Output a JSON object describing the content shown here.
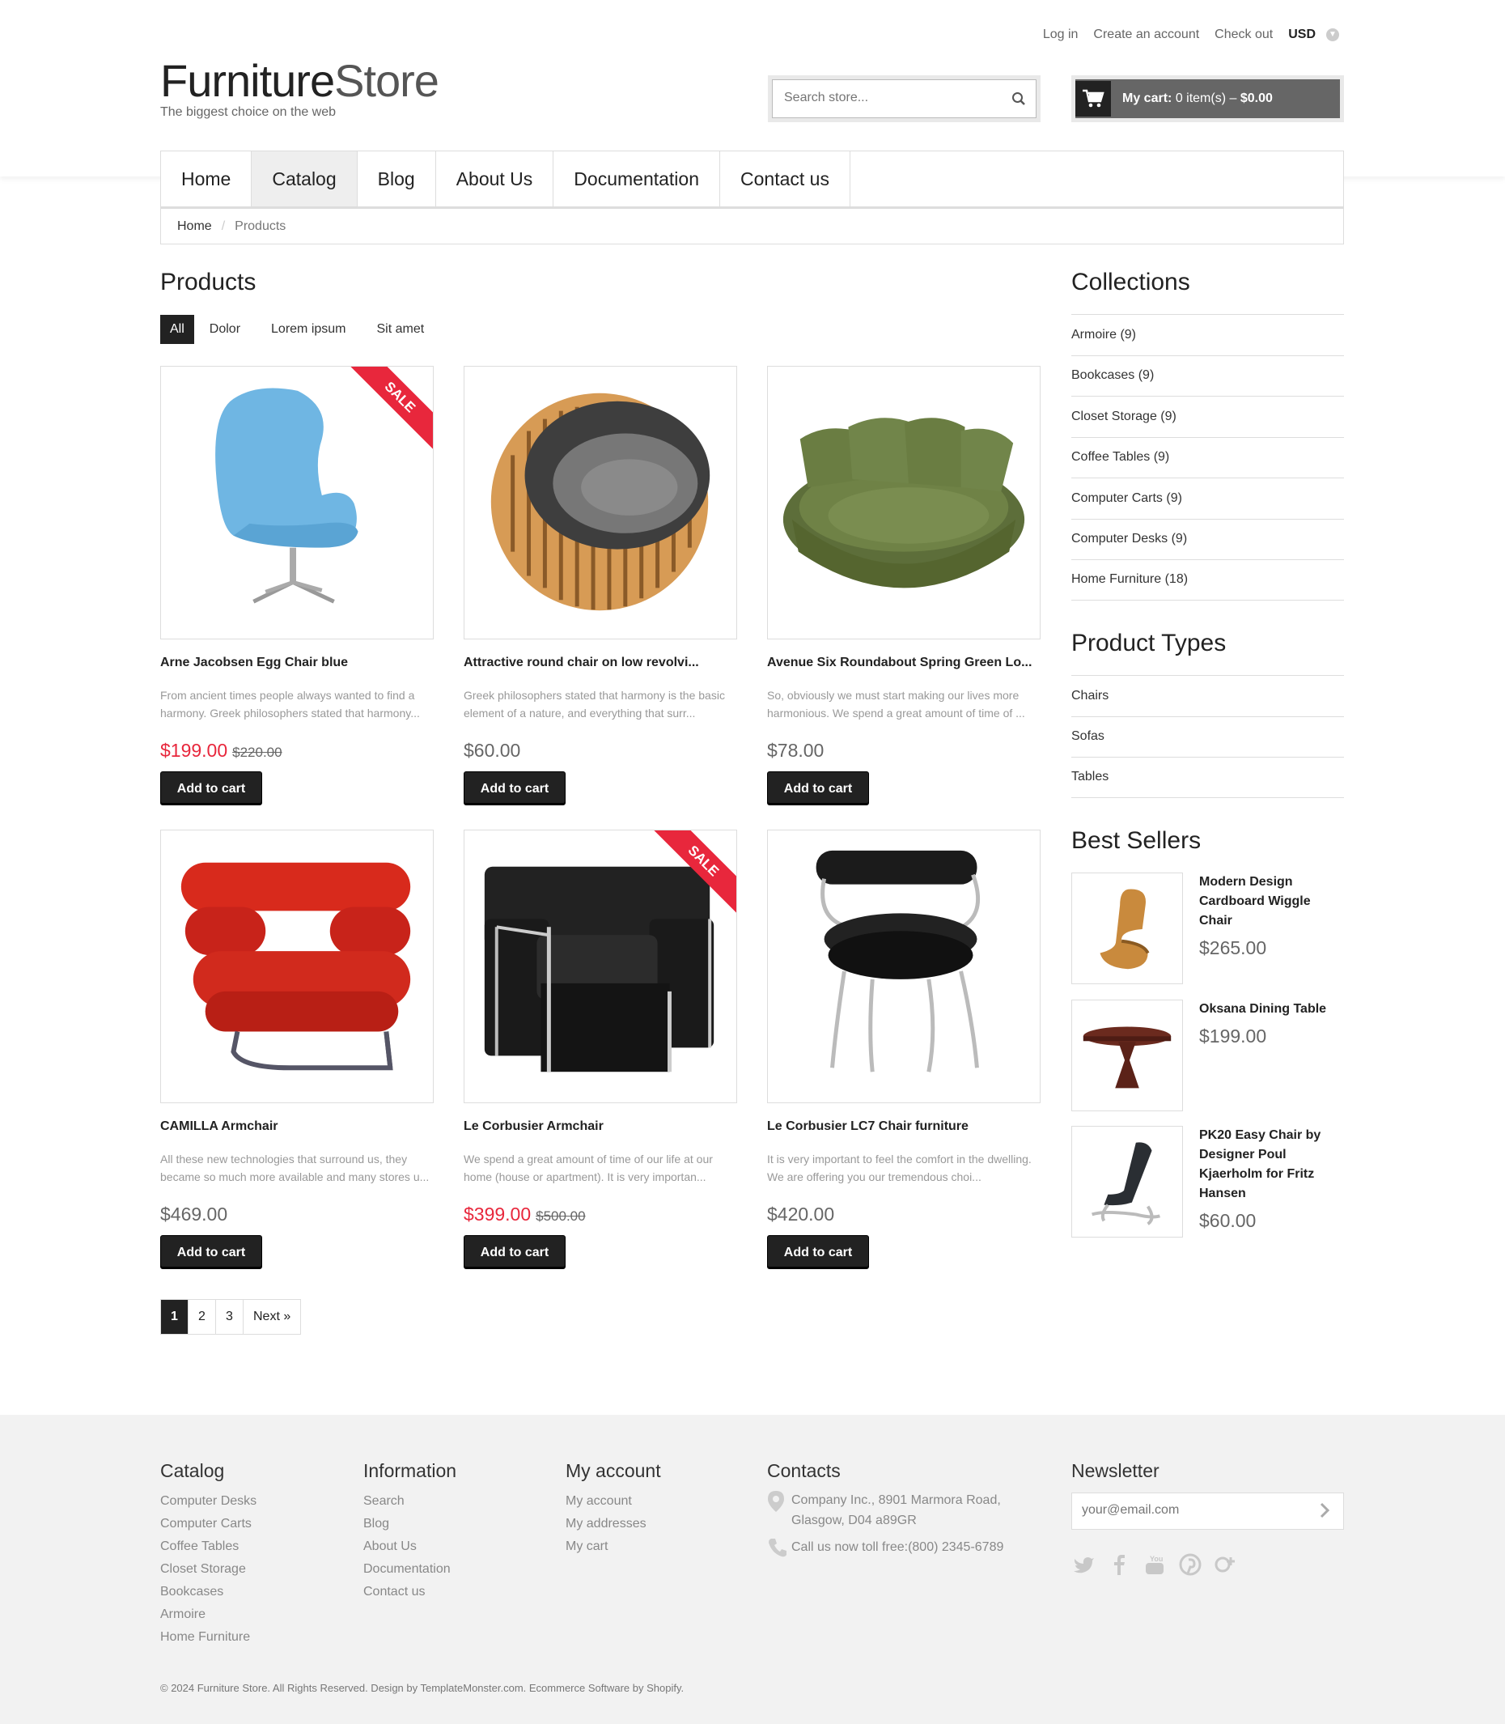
{
  "header": {
    "top_links": [
      "Log in",
      "Create an account",
      "Check out"
    ],
    "currency": "USD",
    "logo_part1": "Furniture",
    "logo_part2": "Store",
    "tagline": "The biggest choice on the web",
    "search_placeholder": "Search store...",
    "cart_label": "My cart:",
    "cart_items": "0 item(s) –",
    "cart_total": "$0.00"
  },
  "nav": [
    "Home",
    "Catalog",
    "Blog",
    "About Us",
    "Documentation",
    "Contact us"
  ],
  "nav_active": "Catalog",
  "breadcrumb": {
    "home": "Home",
    "separator": "/",
    "current": "Products"
  },
  "products_section": {
    "title": "Products",
    "filters": [
      "All",
      "Dolor",
      "Lorem ipsum",
      "Sit amet"
    ],
    "active_filter": "All",
    "add_to_cart": "Add to cart",
    "sale_badge": "SALE"
  },
  "products": [
    {
      "title": "Arne Jacobsen Egg Chair blue",
      "desc": "From ancient times people always wanted to find a harmony. Greek philosophers stated that harmony...",
      "price": "$199.00",
      "old_price": "$220.00",
      "sale": true
    },
    {
      "title": "Attractive round chair on low revolvi...",
      "desc": "Greek philosophers stated that harmony is the basic element of a nature, and everything that surr...",
      "price": "$60.00",
      "old_price": "",
      "sale": false
    },
    {
      "title": "Avenue Six Roundabout Spring Green Lo...",
      "desc": "So, obviously we must start making our lives more harmonious. We spend a great amount of time of ...",
      "price": "$78.00",
      "old_price": "",
      "sale": false
    },
    {
      "title": "CAMILLA Armchair",
      "desc": "All these new technologies that surround us, they became so much more available and many stores u...",
      "price": "$469.00",
      "old_price": "",
      "sale": false
    },
    {
      "title": "Le Corbusier Armchair",
      "desc": "We spend a great amount of time of our life at our home (house or apartment). It is very importan...",
      "price": "$399.00",
      "old_price": "$500.00",
      "sale": true
    },
    {
      "title": "Le Corbusier LC7 Chair furniture",
      "desc": "It is very important to feel the comfort in the dwelling. We are offering you our tremendous choi...",
      "price": "$420.00",
      "old_price": "",
      "sale": false
    }
  ],
  "pagination": {
    "pages": [
      "1",
      "2",
      "3"
    ],
    "active": "1",
    "next": "Next »"
  },
  "sidebar": {
    "collections_title": "Collections",
    "collections": [
      "Armoire (9)",
      "Bookcases (9)",
      "Closet Storage (9)",
      "Coffee Tables (9)",
      "Computer Carts (9)",
      "Computer Desks (9)",
      "Home Furniture (18)"
    ],
    "types_title": "Product Types",
    "types": [
      "Chairs",
      "Sofas",
      "Tables"
    ],
    "bestsellers_title": "Best Sellers",
    "bestsellers": [
      {
        "title": "Modern Design Cardboard Wiggle Chair",
        "price": "$265.00"
      },
      {
        "title": "Oksana Dining Table",
        "price": "$199.00"
      },
      {
        "title": "PK20 Easy Chair by Designer Poul Kjaerholm for Fritz Hansen",
        "price": "$60.00"
      }
    ]
  },
  "footer": {
    "catalog_title": "Catalog",
    "catalog_links": [
      "Computer Desks",
      "Computer Carts",
      "Coffee Tables",
      "Closet Storage",
      "Bookcases",
      "Armoire",
      "Home Furniture"
    ],
    "info_title": "Information",
    "info_links": [
      "Search",
      "Blog",
      "About Us",
      "Documentation",
      "Contact us"
    ],
    "account_title": "My account",
    "account_links": [
      "My account",
      "My addresses",
      "My cart"
    ],
    "contacts_title": "Contacts",
    "address": "Company Inc., 8901 Marmora Road, Glasgow, D04 a89GR",
    "phone": "Call us now toll free:(800) 2345-6789",
    "newsletter_title": "Newsletter",
    "newsletter_placeholder": "your@email.com",
    "copyright": "© 2024 Furniture Store. All Rights Reserved. Design by TemplateMonster.com. Ecommerce Software by Shopify."
  },
  "colors": {
    "accent_sale": "#e8273c",
    "dark": "#222222",
    "footer_bg": "#f2f2f2"
  }
}
